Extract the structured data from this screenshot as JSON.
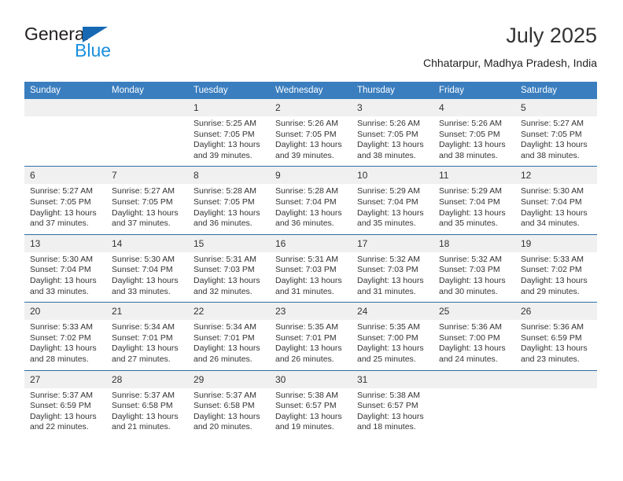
{
  "brand": {
    "name_part1": "General",
    "name_part2": "Blue",
    "triangle_color": "#1668b3",
    "blue_color": "#1a8fdd"
  },
  "header": {
    "title": "July 2025",
    "location": "Chhatarpur, Madhya Pradesh, India"
  },
  "theme": {
    "header_blue": "#3a7ebf",
    "rule_blue": "#2e6da4",
    "daynum_band": "#f0f0f0"
  },
  "calendar": {
    "weekday_headers": [
      "Sunday",
      "Monday",
      "Tuesday",
      "Wednesday",
      "Thursday",
      "Friday",
      "Saturday"
    ],
    "weeks": [
      [
        {
          "day": "",
          "lines": []
        },
        {
          "day": "",
          "lines": []
        },
        {
          "day": "1",
          "lines": [
            "Sunrise: 5:25 AM",
            "Sunset: 7:05 PM",
            "Daylight: 13 hours",
            "and 39 minutes."
          ]
        },
        {
          "day": "2",
          "lines": [
            "Sunrise: 5:26 AM",
            "Sunset: 7:05 PM",
            "Daylight: 13 hours",
            "and 39 minutes."
          ]
        },
        {
          "day": "3",
          "lines": [
            "Sunrise: 5:26 AM",
            "Sunset: 7:05 PM",
            "Daylight: 13 hours",
            "and 38 minutes."
          ]
        },
        {
          "day": "4",
          "lines": [
            "Sunrise: 5:26 AM",
            "Sunset: 7:05 PM",
            "Daylight: 13 hours",
            "and 38 minutes."
          ]
        },
        {
          "day": "5",
          "lines": [
            "Sunrise: 5:27 AM",
            "Sunset: 7:05 PM",
            "Daylight: 13 hours",
            "and 38 minutes."
          ]
        }
      ],
      [
        {
          "day": "6",
          "lines": [
            "Sunrise: 5:27 AM",
            "Sunset: 7:05 PM",
            "Daylight: 13 hours",
            "and 37 minutes."
          ]
        },
        {
          "day": "7",
          "lines": [
            "Sunrise: 5:27 AM",
            "Sunset: 7:05 PM",
            "Daylight: 13 hours",
            "and 37 minutes."
          ]
        },
        {
          "day": "8",
          "lines": [
            "Sunrise: 5:28 AM",
            "Sunset: 7:05 PM",
            "Daylight: 13 hours",
            "and 36 minutes."
          ]
        },
        {
          "day": "9",
          "lines": [
            "Sunrise: 5:28 AM",
            "Sunset: 7:04 PM",
            "Daylight: 13 hours",
            "and 36 minutes."
          ]
        },
        {
          "day": "10",
          "lines": [
            "Sunrise: 5:29 AM",
            "Sunset: 7:04 PM",
            "Daylight: 13 hours",
            "and 35 minutes."
          ]
        },
        {
          "day": "11",
          "lines": [
            "Sunrise: 5:29 AM",
            "Sunset: 7:04 PM",
            "Daylight: 13 hours",
            "and 35 minutes."
          ]
        },
        {
          "day": "12",
          "lines": [
            "Sunrise: 5:30 AM",
            "Sunset: 7:04 PM",
            "Daylight: 13 hours",
            "and 34 minutes."
          ]
        }
      ],
      [
        {
          "day": "13",
          "lines": [
            "Sunrise: 5:30 AM",
            "Sunset: 7:04 PM",
            "Daylight: 13 hours",
            "and 33 minutes."
          ]
        },
        {
          "day": "14",
          "lines": [
            "Sunrise: 5:30 AM",
            "Sunset: 7:04 PM",
            "Daylight: 13 hours",
            "and 33 minutes."
          ]
        },
        {
          "day": "15",
          "lines": [
            "Sunrise: 5:31 AM",
            "Sunset: 7:03 PM",
            "Daylight: 13 hours",
            "and 32 minutes."
          ]
        },
        {
          "day": "16",
          "lines": [
            "Sunrise: 5:31 AM",
            "Sunset: 7:03 PM",
            "Daylight: 13 hours",
            "and 31 minutes."
          ]
        },
        {
          "day": "17",
          "lines": [
            "Sunrise: 5:32 AM",
            "Sunset: 7:03 PM",
            "Daylight: 13 hours",
            "and 31 minutes."
          ]
        },
        {
          "day": "18",
          "lines": [
            "Sunrise: 5:32 AM",
            "Sunset: 7:03 PM",
            "Daylight: 13 hours",
            "and 30 minutes."
          ]
        },
        {
          "day": "19",
          "lines": [
            "Sunrise: 5:33 AM",
            "Sunset: 7:02 PM",
            "Daylight: 13 hours",
            "and 29 minutes."
          ]
        }
      ],
      [
        {
          "day": "20",
          "lines": [
            "Sunrise: 5:33 AM",
            "Sunset: 7:02 PM",
            "Daylight: 13 hours",
            "and 28 minutes."
          ]
        },
        {
          "day": "21",
          "lines": [
            "Sunrise: 5:34 AM",
            "Sunset: 7:01 PM",
            "Daylight: 13 hours",
            "and 27 minutes."
          ]
        },
        {
          "day": "22",
          "lines": [
            "Sunrise: 5:34 AM",
            "Sunset: 7:01 PM",
            "Daylight: 13 hours",
            "and 26 minutes."
          ]
        },
        {
          "day": "23",
          "lines": [
            "Sunrise: 5:35 AM",
            "Sunset: 7:01 PM",
            "Daylight: 13 hours",
            "and 26 minutes."
          ]
        },
        {
          "day": "24",
          "lines": [
            "Sunrise: 5:35 AM",
            "Sunset: 7:00 PM",
            "Daylight: 13 hours",
            "and 25 minutes."
          ]
        },
        {
          "day": "25",
          "lines": [
            "Sunrise: 5:36 AM",
            "Sunset: 7:00 PM",
            "Daylight: 13 hours",
            "and 24 minutes."
          ]
        },
        {
          "day": "26",
          "lines": [
            "Sunrise: 5:36 AM",
            "Sunset: 6:59 PM",
            "Daylight: 13 hours",
            "and 23 minutes."
          ]
        }
      ],
      [
        {
          "day": "27",
          "lines": [
            "Sunrise: 5:37 AM",
            "Sunset: 6:59 PM",
            "Daylight: 13 hours",
            "and 22 minutes."
          ]
        },
        {
          "day": "28",
          "lines": [
            "Sunrise: 5:37 AM",
            "Sunset: 6:58 PM",
            "Daylight: 13 hours",
            "and 21 minutes."
          ]
        },
        {
          "day": "29",
          "lines": [
            "Sunrise: 5:37 AM",
            "Sunset: 6:58 PM",
            "Daylight: 13 hours",
            "and 20 minutes."
          ]
        },
        {
          "day": "30",
          "lines": [
            "Sunrise: 5:38 AM",
            "Sunset: 6:57 PM",
            "Daylight: 13 hours",
            "and 19 minutes."
          ]
        },
        {
          "day": "31",
          "lines": [
            "Sunrise: 5:38 AM",
            "Sunset: 6:57 PM",
            "Daylight: 13 hours",
            "and 18 minutes."
          ]
        },
        {
          "day": "",
          "lines": []
        },
        {
          "day": "",
          "lines": []
        }
      ]
    ]
  }
}
